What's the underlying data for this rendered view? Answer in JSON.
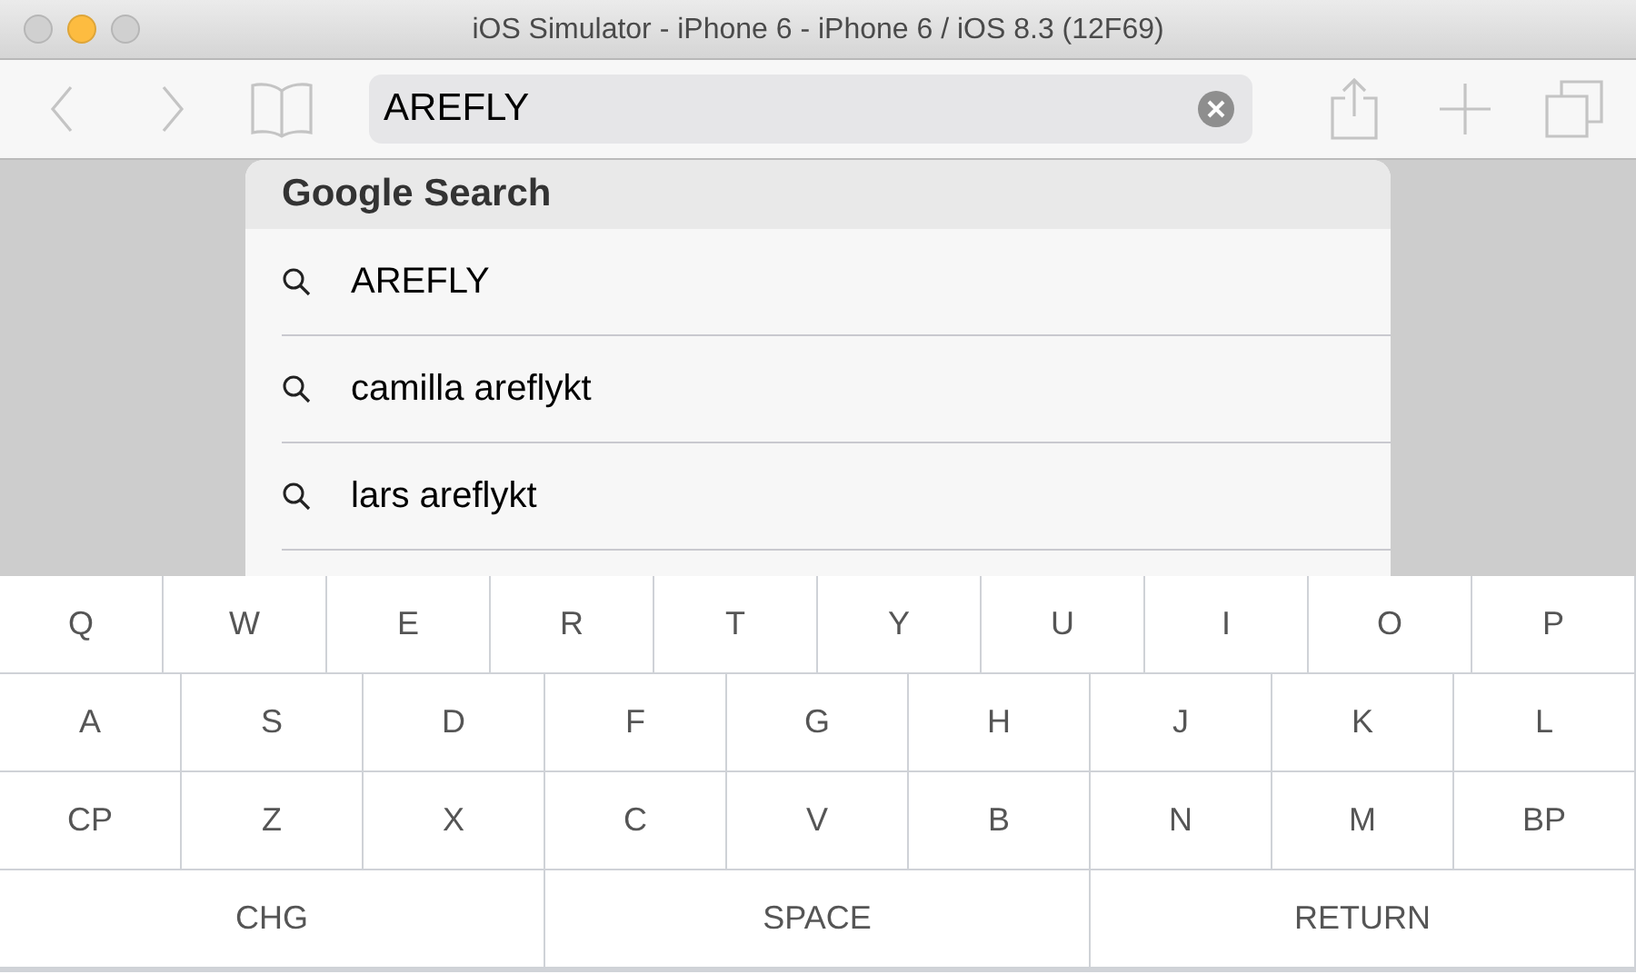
{
  "window": {
    "title": "iOS Simulator - iPhone 6 - iPhone 6 / iOS 8.3 (12F69)",
    "lights": [
      {
        "color": "#d0d0d0"
      },
      {
        "color": "#fdbc40"
      },
      {
        "color": "#d0d0d0"
      }
    ]
  },
  "address_bar": {
    "value": "AREFLY"
  },
  "suggestions": {
    "header": "Google Search",
    "items": [
      "AREFLY",
      "camilla areflykt",
      "lars areflykt"
    ]
  },
  "keyboard": {
    "rows": [
      [
        "Q",
        "W",
        "E",
        "R",
        "T",
        "Y",
        "U",
        "I",
        "O",
        "P"
      ],
      [
        "A",
        "S",
        "D",
        "F",
        "G",
        "H",
        "J",
        "K",
        "L"
      ],
      [
        "CP",
        "Z",
        "X",
        "C",
        "V",
        "B",
        "N",
        "M",
        "BP"
      ]
    ],
    "bottom_keys": [
      {
        "label": "CHG"
      },
      {
        "label": "SPACE"
      },
      {
        "label": "RETURN"
      }
    ]
  }
}
